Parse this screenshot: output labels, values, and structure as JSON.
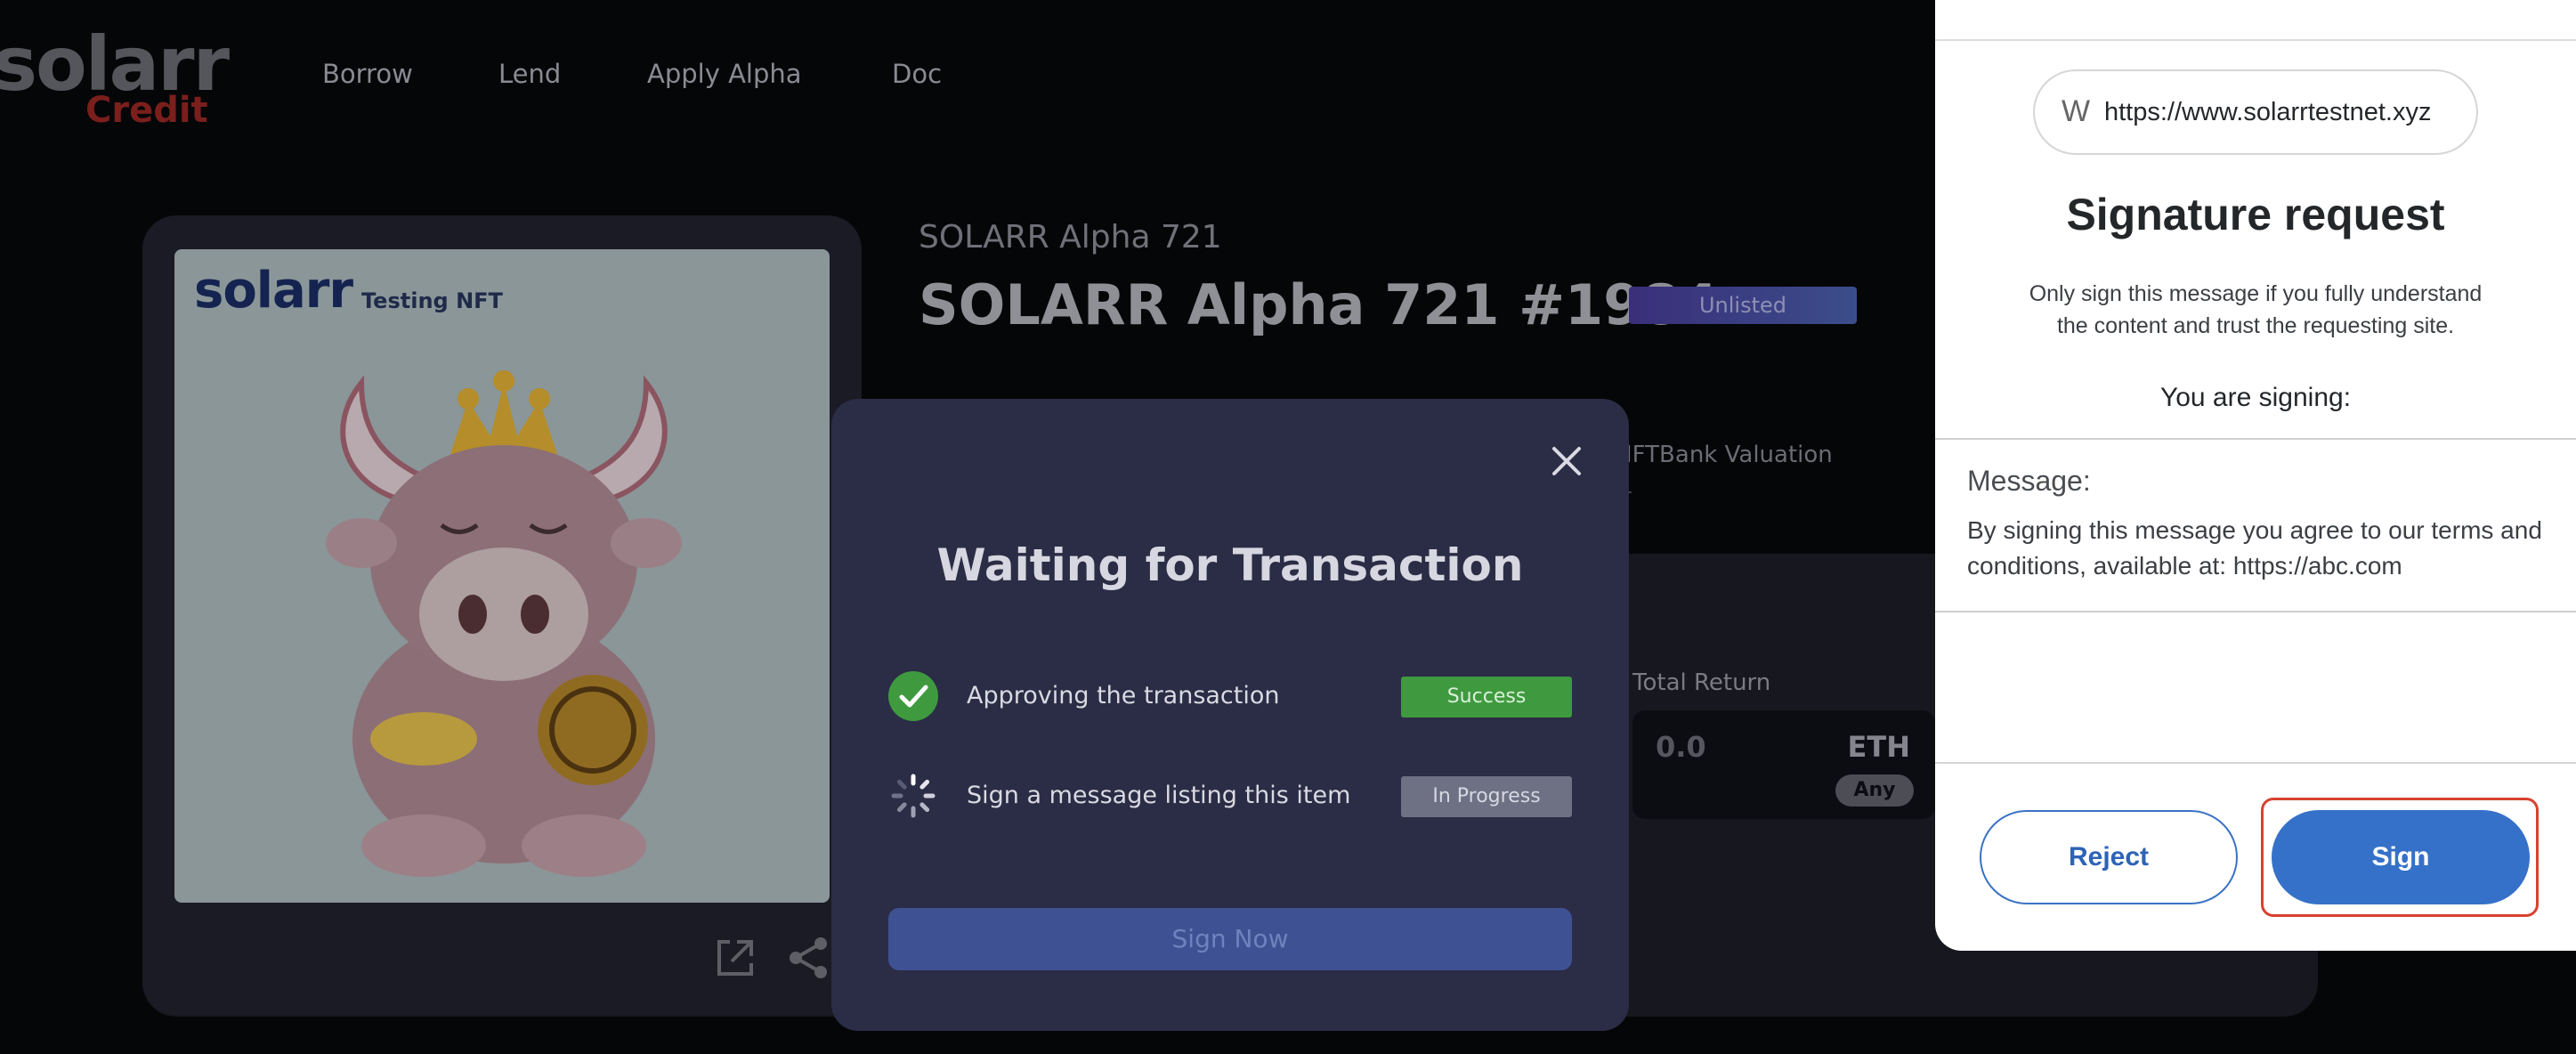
{
  "header": {
    "logo_main": "solarr",
    "logo_sub": "Credit",
    "nav": [
      "Borrow",
      "Lend",
      "Apply Alpha",
      "Doc"
    ]
  },
  "item": {
    "nft_brand": "solarr",
    "nft_subtitle": "Testing NFT",
    "collection": "SOLARR Alpha 721",
    "title": "SOLARR Alpha 721 #1984",
    "status_badge": "Unlisted",
    "valuation_label": "IFTBank Valuation",
    "valuation_value": "-",
    "total_return_label": "Total Return",
    "total_return_value": "0.0",
    "total_return_unit": "ETH",
    "total_return_option": "Any"
  },
  "modal": {
    "title": "Waiting for Transaction",
    "steps": [
      {
        "label": "Approving the transaction",
        "status": "Success"
      },
      {
        "label": "Sign a message listing this item",
        "status": "In Progress"
      }
    ],
    "sign_now_label": "Sign Now"
  },
  "signature": {
    "origin_icon": "W",
    "origin_url": "https://www.solarrtestnet.xyz",
    "title": "Signature request",
    "warning": "Only sign this message if you fully understand the content and trust the requesting site.",
    "signing_label": "You are signing:",
    "message_label": "Message:",
    "message_text": "By signing this message you agree to our terms and conditions, available at: https://abc.com",
    "reject_label": "Reject",
    "sign_label": "Sign"
  },
  "colors": {
    "success": "#3f9a3f",
    "in_progress": "#6e7084",
    "primary_blue": "#3571c8",
    "highlight_red": "#d8412f"
  }
}
